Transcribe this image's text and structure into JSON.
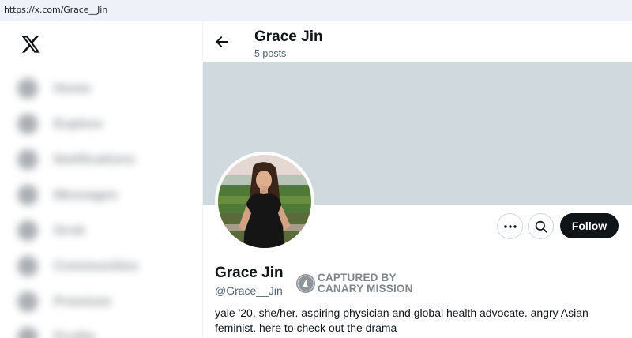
{
  "browser": {
    "url": "https://x.com/Grace__Jin"
  },
  "sidebar": {
    "logo_icon": "x-logo-icon",
    "items": [
      {
        "icon": "home-icon",
        "label": "Home"
      },
      {
        "icon": "explore-icon",
        "label": "Explore"
      },
      {
        "icon": "notifications-icon",
        "label": "Notifications"
      },
      {
        "icon": "messages-icon",
        "label": "Messages"
      },
      {
        "icon": "grok-icon",
        "label": "Grok"
      },
      {
        "icon": "communities-icon",
        "label": "Communities"
      },
      {
        "icon": "premium-icon",
        "label": "Premium"
      },
      {
        "icon": "profile-icon",
        "label": "Profile"
      }
    ]
  },
  "header": {
    "back_icon": "arrow-left-icon",
    "title": "Grace Jin",
    "posts_count": "5 posts"
  },
  "profile": {
    "banner_color": "#cfd9de",
    "display_name": "Grace Jin",
    "handle": "@Grace__Jin",
    "bio": "yale '20, she/her. aspiring physician and global health advocate. angry Asian feminist. here to check out the drama",
    "actions": {
      "more_icon": "more-dots-icon",
      "search_icon": "search-icon",
      "follow_label": "Follow"
    }
  },
  "watermark": {
    "line1": "CAPTURED BY",
    "line2": "CANARY MISSION"
  },
  "colors": {
    "text": "#0f1419",
    "secondary": "#536471",
    "follow_bg": "#0f1419",
    "border": "#cfd9de"
  }
}
